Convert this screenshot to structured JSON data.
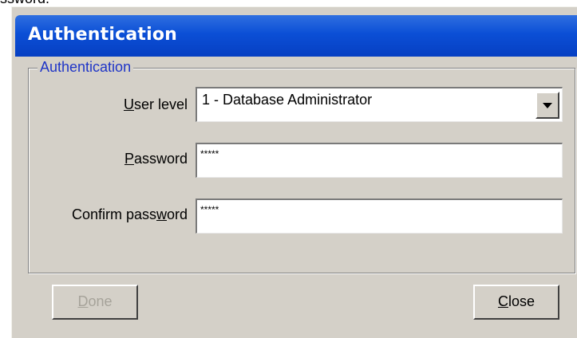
{
  "page_top_text": "ssword.",
  "window": {
    "title": "Authentication"
  },
  "group": {
    "legend": "Authentication"
  },
  "form": {
    "user_level": {
      "label_pre": "",
      "label_key": "U",
      "label_post": "ser level",
      "value": "1 - Database Administrator"
    },
    "password": {
      "label_pre": "",
      "label_key": "P",
      "label_post": "assword",
      "value": "*****"
    },
    "confirm_password": {
      "label_pre": "Confirm pass",
      "label_key": "w",
      "label_post": "ord",
      "value": "*****"
    }
  },
  "buttons": {
    "done": {
      "key": "D",
      "rest": "one",
      "enabled": false
    },
    "close": {
      "key": "C",
      "rest": "lose",
      "enabled": true
    }
  }
}
